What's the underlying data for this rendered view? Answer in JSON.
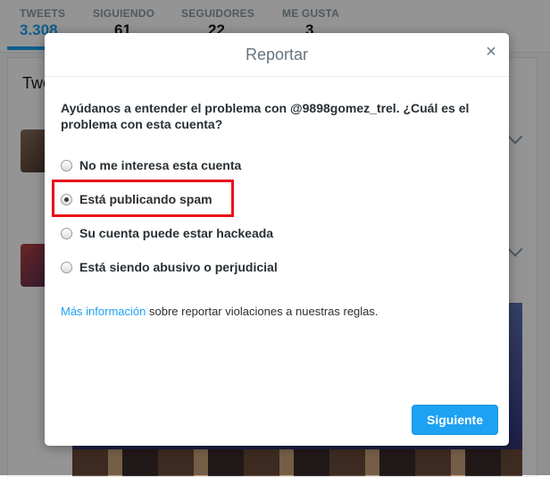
{
  "profile_stats": [
    {
      "label": "TWEETS",
      "value": "3.308"
    },
    {
      "label": "SIGUIENDO",
      "value": "61"
    },
    {
      "label": "SEGUIDORES",
      "value": "22"
    },
    {
      "label": "ME GUSTA",
      "value": "3"
    }
  ],
  "feed": {
    "title": "Twe"
  },
  "modal": {
    "title": "Reportar",
    "close_label": "×",
    "question": "Ayúdanos a entender el problema con @9898gomez_trel. ¿Cuál es el problema con esta cuenta?",
    "options": [
      {
        "label": "No me interesa esta cuenta",
        "selected": false
      },
      {
        "label": "Está publicando spam",
        "selected": true
      },
      {
        "label": "Su cuenta puede estar hackeada",
        "selected": false
      },
      {
        "label": "Está siendo abusivo o perjudicial",
        "selected": false
      }
    ],
    "info_link": "Más información",
    "info_text": " sobre reportar violaciones a nuestras reglas.",
    "next_button": "Siguiente"
  },
  "colors": {
    "accent": "#1da1f2",
    "highlight": "#e8101a"
  }
}
